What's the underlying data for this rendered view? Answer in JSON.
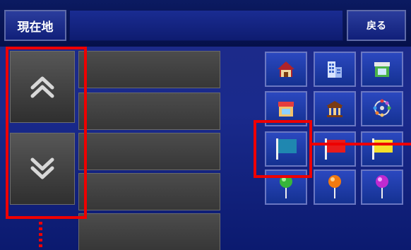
{
  "header": {
    "current_location_label": "現在地",
    "back_label": "戻る"
  },
  "list": {
    "rows": [
      "",
      "",
      "",
      "",
      ""
    ]
  },
  "scroll": {
    "up_icon": "double-chevron-up-icon",
    "down_icon": "double-chevron-down-icon"
  },
  "categories": [
    {
      "name": "house-icon"
    },
    {
      "name": "building-icon"
    },
    {
      "name": "shop-icon"
    },
    {
      "name": "storefront-icon"
    },
    {
      "name": "bank-icon"
    },
    {
      "name": "ferris-wheel-icon"
    },
    {
      "name": "flag-blue-icon"
    },
    {
      "name": "flag-red-icon"
    },
    {
      "name": "flag-yellow-icon"
    },
    {
      "name": "pin-green-icon"
    },
    {
      "name": "pin-orange-icon"
    },
    {
      "name": "pin-purple-icon"
    }
  ],
  "colors": {
    "accent_red": "#ee0000",
    "panel_blue": "#1a2a8c",
    "button_gray": "#3f3f3f"
  }
}
